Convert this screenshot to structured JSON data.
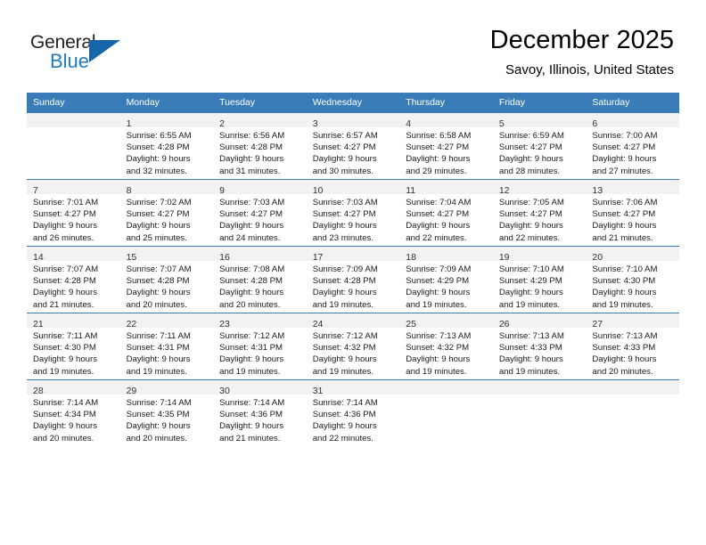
{
  "brand": {
    "name_top": "General",
    "name_bottom": "Blue",
    "logo_color": "#1565a8",
    "text_color": "#231f20",
    "blue_text_color": "#1f7bc1"
  },
  "header": {
    "title": "December 2025",
    "subtitle": "Savoy, Illinois, United States"
  },
  "theme": {
    "header_blue": "#3a7cb8",
    "band_gray": "#f2f2f2",
    "text": "#000000"
  },
  "weekdays": [
    "Sunday",
    "Monday",
    "Tuesday",
    "Wednesday",
    "Thursday",
    "Friday",
    "Saturday"
  ],
  "weeks": [
    [
      {
        "day": "",
        "sunrise": "",
        "sunset": "",
        "daylight_1": "",
        "daylight_2": ""
      },
      {
        "day": "1",
        "sunrise": "Sunrise: 6:55 AM",
        "sunset": "Sunset: 4:28 PM",
        "daylight_1": "Daylight: 9 hours",
        "daylight_2": "and 32 minutes."
      },
      {
        "day": "2",
        "sunrise": "Sunrise: 6:56 AM",
        "sunset": "Sunset: 4:28 PM",
        "daylight_1": "Daylight: 9 hours",
        "daylight_2": "and 31 minutes."
      },
      {
        "day": "3",
        "sunrise": "Sunrise: 6:57 AM",
        "sunset": "Sunset: 4:27 PM",
        "daylight_1": "Daylight: 9 hours",
        "daylight_2": "and 30 minutes."
      },
      {
        "day": "4",
        "sunrise": "Sunrise: 6:58 AM",
        "sunset": "Sunset: 4:27 PM",
        "daylight_1": "Daylight: 9 hours",
        "daylight_2": "and 29 minutes."
      },
      {
        "day": "5",
        "sunrise": "Sunrise: 6:59 AM",
        "sunset": "Sunset: 4:27 PM",
        "daylight_1": "Daylight: 9 hours",
        "daylight_2": "and 28 minutes."
      },
      {
        "day": "6",
        "sunrise": "Sunrise: 7:00 AM",
        "sunset": "Sunset: 4:27 PM",
        "daylight_1": "Daylight: 9 hours",
        "daylight_2": "and 27 minutes."
      }
    ],
    [
      {
        "day": "7",
        "sunrise": "Sunrise: 7:01 AM",
        "sunset": "Sunset: 4:27 PM",
        "daylight_1": "Daylight: 9 hours",
        "daylight_2": "and 26 minutes."
      },
      {
        "day": "8",
        "sunrise": "Sunrise: 7:02 AM",
        "sunset": "Sunset: 4:27 PM",
        "daylight_1": "Daylight: 9 hours",
        "daylight_2": "and 25 minutes."
      },
      {
        "day": "9",
        "sunrise": "Sunrise: 7:03 AM",
        "sunset": "Sunset: 4:27 PM",
        "daylight_1": "Daylight: 9 hours",
        "daylight_2": "and 24 minutes."
      },
      {
        "day": "10",
        "sunrise": "Sunrise: 7:03 AM",
        "sunset": "Sunset: 4:27 PM",
        "daylight_1": "Daylight: 9 hours",
        "daylight_2": "and 23 minutes."
      },
      {
        "day": "11",
        "sunrise": "Sunrise: 7:04 AM",
        "sunset": "Sunset: 4:27 PM",
        "daylight_1": "Daylight: 9 hours",
        "daylight_2": "and 22 minutes."
      },
      {
        "day": "12",
        "sunrise": "Sunrise: 7:05 AM",
        "sunset": "Sunset: 4:27 PM",
        "daylight_1": "Daylight: 9 hours",
        "daylight_2": "and 22 minutes."
      },
      {
        "day": "13",
        "sunrise": "Sunrise: 7:06 AM",
        "sunset": "Sunset: 4:27 PM",
        "daylight_1": "Daylight: 9 hours",
        "daylight_2": "and 21 minutes."
      }
    ],
    [
      {
        "day": "14",
        "sunrise": "Sunrise: 7:07 AM",
        "sunset": "Sunset: 4:28 PM",
        "daylight_1": "Daylight: 9 hours",
        "daylight_2": "and 21 minutes."
      },
      {
        "day": "15",
        "sunrise": "Sunrise: 7:07 AM",
        "sunset": "Sunset: 4:28 PM",
        "daylight_1": "Daylight: 9 hours",
        "daylight_2": "and 20 minutes."
      },
      {
        "day": "16",
        "sunrise": "Sunrise: 7:08 AM",
        "sunset": "Sunset: 4:28 PM",
        "daylight_1": "Daylight: 9 hours",
        "daylight_2": "and 20 minutes."
      },
      {
        "day": "17",
        "sunrise": "Sunrise: 7:09 AM",
        "sunset": "Sunset: 4:28 PM",
        "daylight_1": "Daylight: 9 hours",
        "daylight_2": "and 19 minutes."
      },
      {
        "day": "18",
        "sunrise": "Sunrise: 7:09 AM",
        "sunset": "Sunset: 4:29 PM",
        "daylight_1": "Daylight: 9 hours",
        "daylight_2": "and 19 minutes."
      },
      {
        "day": "19",
        "sunrise": "Sunrise: 7:10 AM",
        "sunset": "Sunset: 4:29 PM",
        "daylight_1": "Daylight: 9 hours",
        "daylight_2": "and 19 minutes."
      },
      {
        "day": "20",
        "sunrise": "Sunrise: 7:10 AM",
        "sunset": "Sunset: 4:30 PM",
        "daylight_1": "Daylight: 9 hours",
        "daylight_2": "and 19 minutes."
      }
    ],
    [
      {
        "day": "21",
        "sunrise": "Sunrise: 7:11 AM",
        "sunset": "Sunset: 4:30 PM",
        "daylight_1": "Daylight: 9 hours",
        "daylight_2": "and 19 minutes."
      },
      {
        "day": "22",
        "sunrise": "Sunrise: 7:11 AM",
        "sunset": "Sunset: 4:31 PM",
        "daylight_1": "Daylight: 9 hours",
        "daylight_2": "and 19 minutes."
      },
      {
        "day": "23",
        "sunrise": "Sunrise: 7:12 AM",
        "sunset": "Sunset: 4:31 PM",
        "daylight_1": "Daylight: 9 hours",
        "daylight_2": "and 19 minutes."
      },
      {
        "day": "24",
        "sunrise": "Sunrise: 7:12 AM",
        "sunset": "Sunset: 4:32 PM",
        "daylight_1": "Daylight: 9 hours",
        "daylight_2": "and 19 minutes."
      },
      {
        "day": "25",
        "sunrise": "Sunrise: 7:13 AM",
        "sunset": "Sunset: 4:32 PM",
        "daylight_1": "Daylight: 9 hours",
        "daylight_2": "and 19 minutes."
      },
      {
        "day": "26",
        "sunrise": "Sunrise: 7:13 AM",
        "sunset": "Sunset: 4:33 PM",
        "daylight_1": "Daylight: 9 hours",
        "daylight_2": "and 19 minutes."
      },
      {
        "day": "27",
        "sunrise": "Sunrise: 7:13 AM",
        "sunset": "Sunset: 4:33 PM",
        "daylight_1": "Daylight: 9 hours",
        "daylight_2": "and 20 minutes."
      }
    ],
    [
      {
        "day": "28",
        "sunrise": "Sunrise: 7:14 AM",
        "sunset": "Sunset: 4:34 PM",
        "daylight_1": "Daylight: 9 hours",
        "daylight_2": "and 20 minutes."
      },
      {
        "day": "29",
        "sunrise": "Sunrise: 7:14 AM",
        "sunset": "Sunset: 4:35 PM",
        "daylight_1": "Daylight: 9 hours",
        "daylight_2": "and 20 minutes."
      },
      {
        "day": "30",
        "sunrise": "Sunrise: 7:14 AM",
        "sunset": "Sunset: 4:36 PM",
        "daylight_1": "Daylight: 9 hours",
        "daylight_2": "and 21 minutes."
      },
      {
        "day": "31",
        "sunrise": "Sunrise: 7:14 AM",
        "sunset": "Sunset: 4:36 PM",
        "daylight_1": "Daylight: 9 hours",
        "daylight_2": "and 22 minutes."
      },
      {
        "day": "",
        "sunrise": "",
        "sunset": "",
        "daylight_1": "",
        "daylight_2": ""
      },
      {
        "day": "",
        "sunrise": "",
        "sunset": "",
        "daylight_1": "",
        "daylight_2": ""
      },
      {
        "day": "",
        "sunrise": "",
        "sunset": "",
        "daylight_1": "",
        "daylight_2": ""
      }
    ]
  ]
}
